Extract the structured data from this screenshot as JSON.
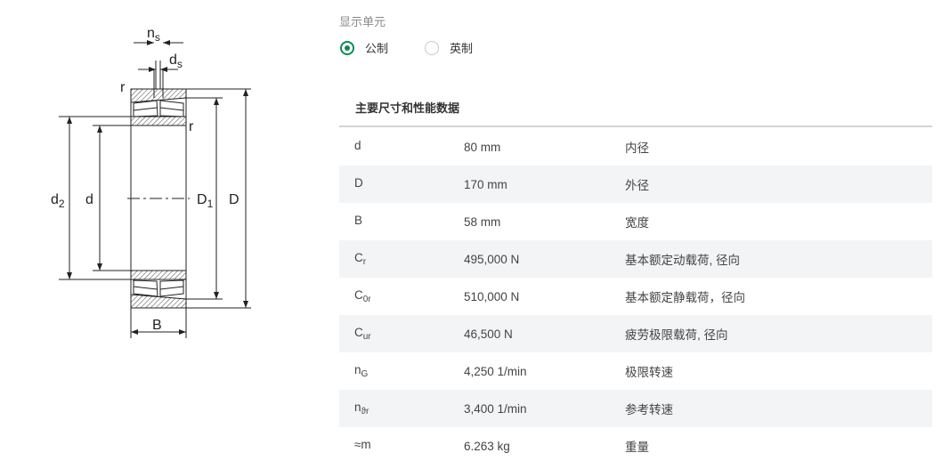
{
  "diagram": {
    "labels": {
      "ns_main": "n",
      "ns_sub": "s",
      "ds_main": "d",
      "ds_sub": "s",
      "r_top": "r",
      "r_right": "r",
      "d2_main": "d",
      "d2_sub": "2",
      "d": "d",
      "D1_main": "D",
      "D1_sub": "1",
      "D": "D",
      "B": "B"
    }
  },
  "unit_selector": {
    "caption": "显示单元",
    "options": [
      {
        "label": "公制",
        "selected": true
      },
      {
        "label": "英制",
        "selected": false
      }
    ],
    "accent_color": "#0e8a4f"
  },
  "specs": {
    "title": "主要尺寸和性能数据",
    "rows": [
      {
        "sym": "d",
        "sub": "",
        "value": "80 mm",
        "desc": "内径"
      },
      {
        "sym": "D",
        "sub": "",
        "value": "170 mm",
        "desc": "外径"
      },
      {
        "sym": "B",
        "sub": "",
        "value": "58 mm",
        "desc": "宽度"
      },
      {
        "sym": "C",
        "sub": "r",
        "value": "495,000 N",
        "desc": "基本额定动载荷, 径向"
      },
      {
        "sym": "C",
        "sub": "0r",
        "value": "510,000 N",
        "desc": "基本额定静载荷，径向"
      },
      {
        "sym": "C",
        "sub": "ur",
        "value": "46,500 N",
        "desc": "疲劳极限载荷, 径向"
      },
      {
        "sym": "n",
        "sub": "G",
        "value": "4,250 1/min",
        "desc": "极限转速"
      },
      {
        "sym": "n",
        "sub": "ϑr",
        "value": "3,400 1/min",
        "desc": "参考转速"
      },
      {
        "sym": "≈m",
        "sub": "",
        "value": "6.263 kg",
        "desc": "重量"
      }
    ]
  }
}
